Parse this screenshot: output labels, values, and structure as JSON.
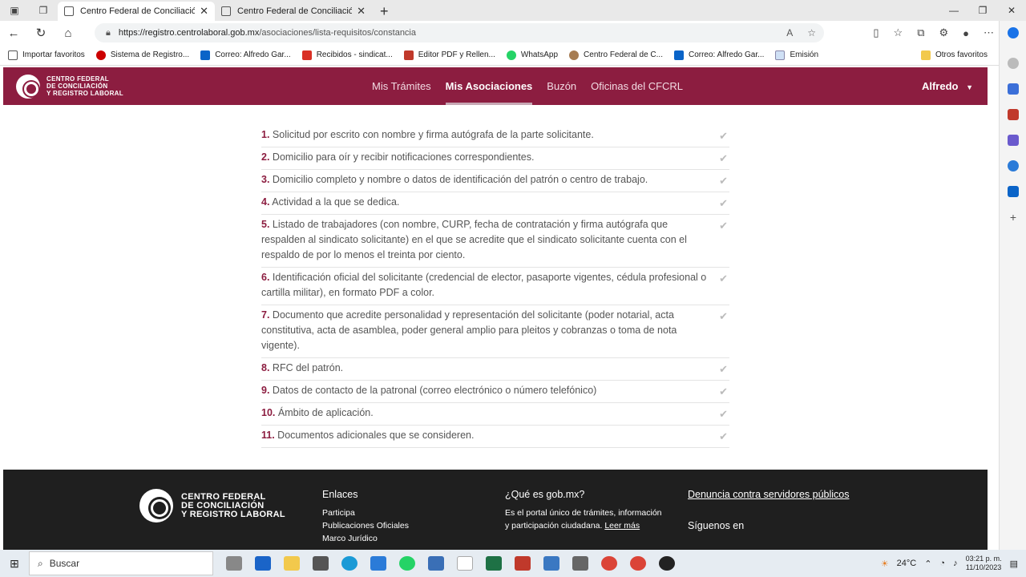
{
  "browser": {
    "tabs": [
      {
        "title": "Centro Federal de Conciliación y",
        "active": true
      },
      {
        "title": "Centro Federal de Conciliación y",
        "active": false
      }
    ],
    "url_host": "https://registro.centrolaboral.gob.mx",
    "url_path": "/asociaciones/lista-requisitos/constancia",
    "bookmarks": [
      "Importar favoritos",
      "Sistema de Registro...",
      "Correo: Alfredo Gar...",
      "Recibidos - sindicat...",
      "Editor PDF y Rellen...",
      "WhatsApp",
      "Centro Federal de C...",
      "Correo: Alfredo Gar...",
      "Emisión"
    ],
    "bookmarks_right": "Otros favoritos"
  },
  "header": {
    "logo_lines": [
      "CENTRO FEDERAL",
      "DE CONCILIACIÓN",
      "Y REGISTRO LABORAL"
    ],
    "nav": [
      "Mis Trámites",
      "Mis Asociaciones",
      "Buzón",
      "Oficinas del CFCRL"
    ],
    "user": "Alfredo"
  },
  "requirements": [
    {
      "num": "1.",
      "text": "Solicitud por escrito con nombre y firma autógrafa de la parte solicitante."
    },
    {
      "num": "2.",
      "text": "Domicilio para oír y recibir notificaciones correspondientes."
    },
    {
      "num": "3.",
      "text": "Domicilio completo y nombre o datos de identificación del patrón o centro de trabajo."
    },
    {
      "num": "4.",
      "text": "Actividad a la que se dedica."
    },
    {
      "num": "5.",
      "text": "Listado de trabajadores (con nombre, CURP, fecha de contratación y firma autógrafa que respalden al sindicato solicitante) en el que se acredite que el sindicato solicitante cuenta con el respaldo de por lo menos el treinta por ciento."
    },
    {
      "num": "6.",
      "text": "Identificación oficial del solicitante (credencial de elector, pasaporte vigentes, cédula profesional o cartilla militar), en formato PDF a color."
    },
    {
      "num": "7.",
      "text": "Documento que acredite personalidad y representación del solicitante (poder notarial, acta constitutiva, acta de asamblea, poder general amplio para pleitos y cobranzas o toma de nota vigente)."
    },
    {
      "num": "8.",
      "text": "RFC del patrón."
    },
    {
      "num": "9.",
      "text": "Datos de contacto de la patronal (correo electrónico o número telefónico)"
    },
    {
      "num": "10.",
      "text": "Ámbito de aplicación."
    },
    {
      "num": "11.",
      "text": "Documentos adicionales que se consideren."
    }
  ],
  "footer": {
    "logo_lines": [
      "CENTRO FEDERAL",
      "DE CONCILIACIÓN",
      "Y REGISTRO LABORAL"
    ],
    "enlaces_title": "Enlaces",
    "enlaces": [
      "Participa",
      "Publicaciones Oficiales",
      "Marco Jurídico"
    ],
    "gob_title": "¿Qué es gob.mx?",
    "gob_text": "Es el portal único de trámites, información y participación ciudadana.",
    "gob_link": "Leer más",
    "denuncia": "Denuncia contra servidores públicos",
    "siguenos": "Síguenos en"
  },
  "taskbar": {
    "search": "Buscar",
    "temp": "24°C",
    "time": "03:21 p. m.",
    "date": "11/10/2023"
  }
}
